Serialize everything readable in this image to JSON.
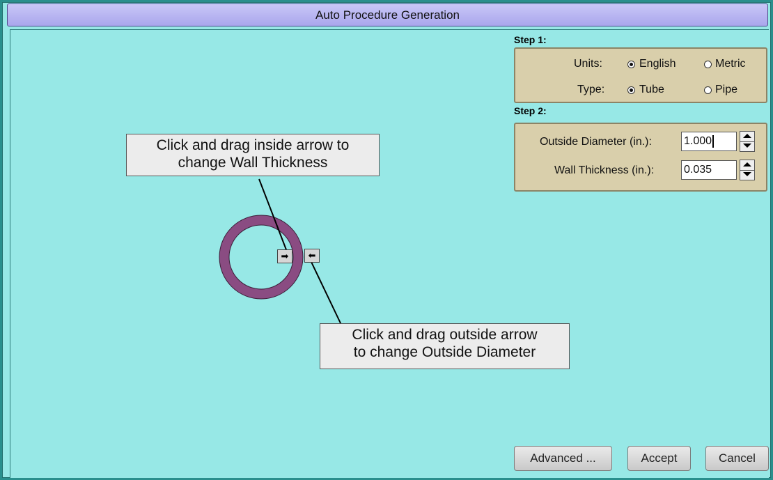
{
  "window": {
    "title": "Auto Procedure Generation"
  },
  "step1": {
    "label": "Step 1:",
    "units_label": "Units:",
    "units_options": [
      "English",
      "Metric"
    ],
    "units_selected": "English",
    "type_label": "Type:",
    "type_options": [
      "Tube",
      "Pipe"
    ],
    "type_selected": "Tube"
  },
  "step2": {
    "label": "Step 2:",
    "od_label": "Outside Diameter (in.):",
    "od_value": "1.000",
    "wt_label": "Wall Thickness (in.):",
    "wt_value": "0.035"
  },
  "callouts": {
    "inside": [
      "Click and drag inside arrow to",
      "change Wall Thickness"
    ],
    "outside": [
      "Click and drag outside arrow",
      "to change Outside Diameter"
    ]
  },
  "handles": {
    "inside_glyph": "➡",
    "outside_glyph": "⬅"
  },
  "colors": {
    "tube": "#8a4c82",
    "background": "#97e8e6",
    "panel": "#d9cfab"
  },
  "buttons": {
    "advanced": "Advanced ...",
    "accept": "Accept",
    "cancel": "Cancel"
  }
}
